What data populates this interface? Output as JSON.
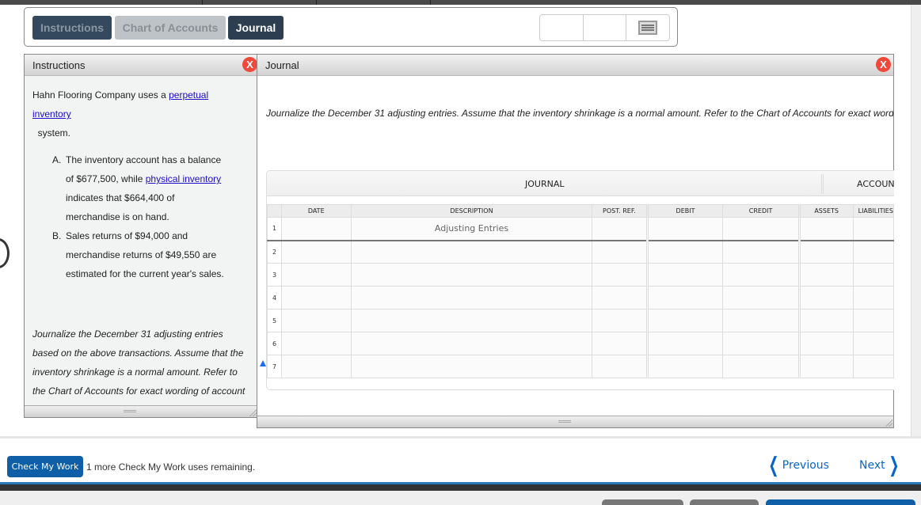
{
  "tabs": [
    {
      "label": "Instructions",
      "active": false
    },
    {
      "label": "Chart of Accounts",
      "active": false
    },
    {
      "label": "Journal",
      "active": true
    }
  ],
  "toolbar": {
    "tools": [
      "blank-tool-1",
      "blank-tool-2",
      "menu-icon"
    ]
  },
  "instructions_panel": {
    "title": "Instructions",
    "close_label": "X",
    "intro_before_link": "Hahn Flooring Company uses a ",
    "intro_link": "perpetual inventory",
    "intro_after_link": " system.",
    "items": [
      {
        "marker": "A.",
        "text_before_link": "The inventory account has a balance of $677,500, while ",
        "link": "physical inventory",
        "text_after_link": " indicates that $664,400 of merchandise is on hand."
      },
      {
        "marker": "B.",
        "text": "Sales returns of $94,000 and merchandise returns of $49,550 are estimated for the current year's sales."
      }
    ],
    "task": "Journalize the December 31 adjusting entries based on the above transactions. Assume that the inventory shrinkage is a normal amount. Refer to the Chart of Accounts for exact wording of account titles."
  },
  "journal_panel": {
    "title": "Journal",
    "close_label": "X",
    "instruction": "Journalize the December 31 adjusting entries. Assume that the inventory shrinkage is a normal amount. Refer to the Chart of Accounts for exact wording of account titles.",
    "table": {
      "group_headers": {
        "journal": "JOURNAL",
        "accounting": "ACCOUNTING EQUATION"
      },
      "columns": [
        "DATE",
        "DESCRIPTION",
        "POST. REF.",
        "DEBIT",
        "CREDIT",
        "ASSETS",
        "LIABILITIES"
      ],
      "rows": [
        {
          "num": "1",
          "date": "",
          "description": "Adjusting Entries",
          "post_ref": "",
          "debit": "",
          "credit": "",
          "assets": "",
          "liabilities": ""
        },
        {
          "num": "2",
          "date": "",
          "description": "",
          "post_ref": "",
          "debit": "",
          "credit": "",
          "assets": "",
          "liabilities": ""
        },
        {
          "num": "3",
          "date": "",
          "description": "",
          "post_ref": "",
          "debit": "",
          "credit": "",
          "assets": "",
          "liabilities": ""
        },
        {
          "num": "4",
          "date": "",
          "description": "",
          "post_ref": "",
          "debit": "",
          "credit": "",
          "assets": "",
          "liabilities": ""
        },
        {
          "num": "5",
          "date": "",
          "description": "",
          "post_ref": "",
          "debit": "",
          "credit": "",
          "assets": "",
          "liabilities": ""
        },
        {
          "num": "6",
          "date": "",
          "description": "",
          "post_ref": "",
          "debit": "",
          "credit": "",
          "assets": "",
          "liabilities": ""
        },
        {
          "num": "7",
          "date": "",
          "description": "",
          "post_ref": "",
          "debit": "",
          "credit": "",
          "assets": "",
          "liabilities": ""
        }
      ]
    }
  },
  "bottom": {
    "check_button": "Check My Work",
    "check_note": "1 more Check My Work uses remaining.",
    "previous": "Previous",
    "next": "Next",
    "prev_icon": "❮",
    "next_icon": "❯"
  },
  "colors": {
    "tab_active": "#2c3e50",
    "close": "#f0483a",
    "link": "#1a0dcc",
    "primary_button": "#0f5ea8",
    "nav_link": "#0a64c8"
  }
}
